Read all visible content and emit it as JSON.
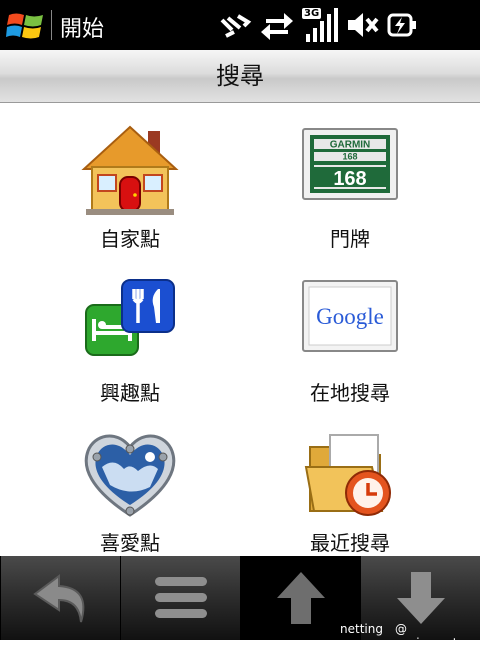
{
  "statusbar": {
    "start_label": "開始",
    "network_badge": "3G"
  },
  "titlebar": {
    "title": "搜尋"
  },
  "grid": {
    "items": [
      {
        "label": "自家點",
        "icon": "home-icon"
      },
      {
        "label": "門牌",
        "icon": "address-sign-icon"
      },
      {
        "label": "興趣點",
        "icon": "poi-icon"
      },
      {
        "label": "在地搜尋",
        "icon": "google-icon"
      },
      {
        "label": "喜愛點",
        "icon": "favorite-heart-icon"
      },
      {
        "label": "最近搜尋",
        "icon": "recent-folder-icon"
      }
    ],
    "garmin": {
      "brand": "GARMIN",
      "small_number": "168",
      "big_number": "168"
    },
    "google_text": "Google"
  },
  "toolbar": {
    "buttons": [
      "back-icon",
      "menu-icon",
      "up-arrow-icon",
      "down-arrow-icon"
    ]
  },
  "watermark": {
    "left": "netting",
    "right": "@ sogi.com.tw"
  },
  "colors": {
    "statusbar_bg": "#000000",
    "toolbar_bg": "#000000",
    "house_roof": "#d98a1e",
    "door": "#d81010",
    "poi_blue": "#1b4fd1",
    "poi_green": "#2ea82e"
  }
}
